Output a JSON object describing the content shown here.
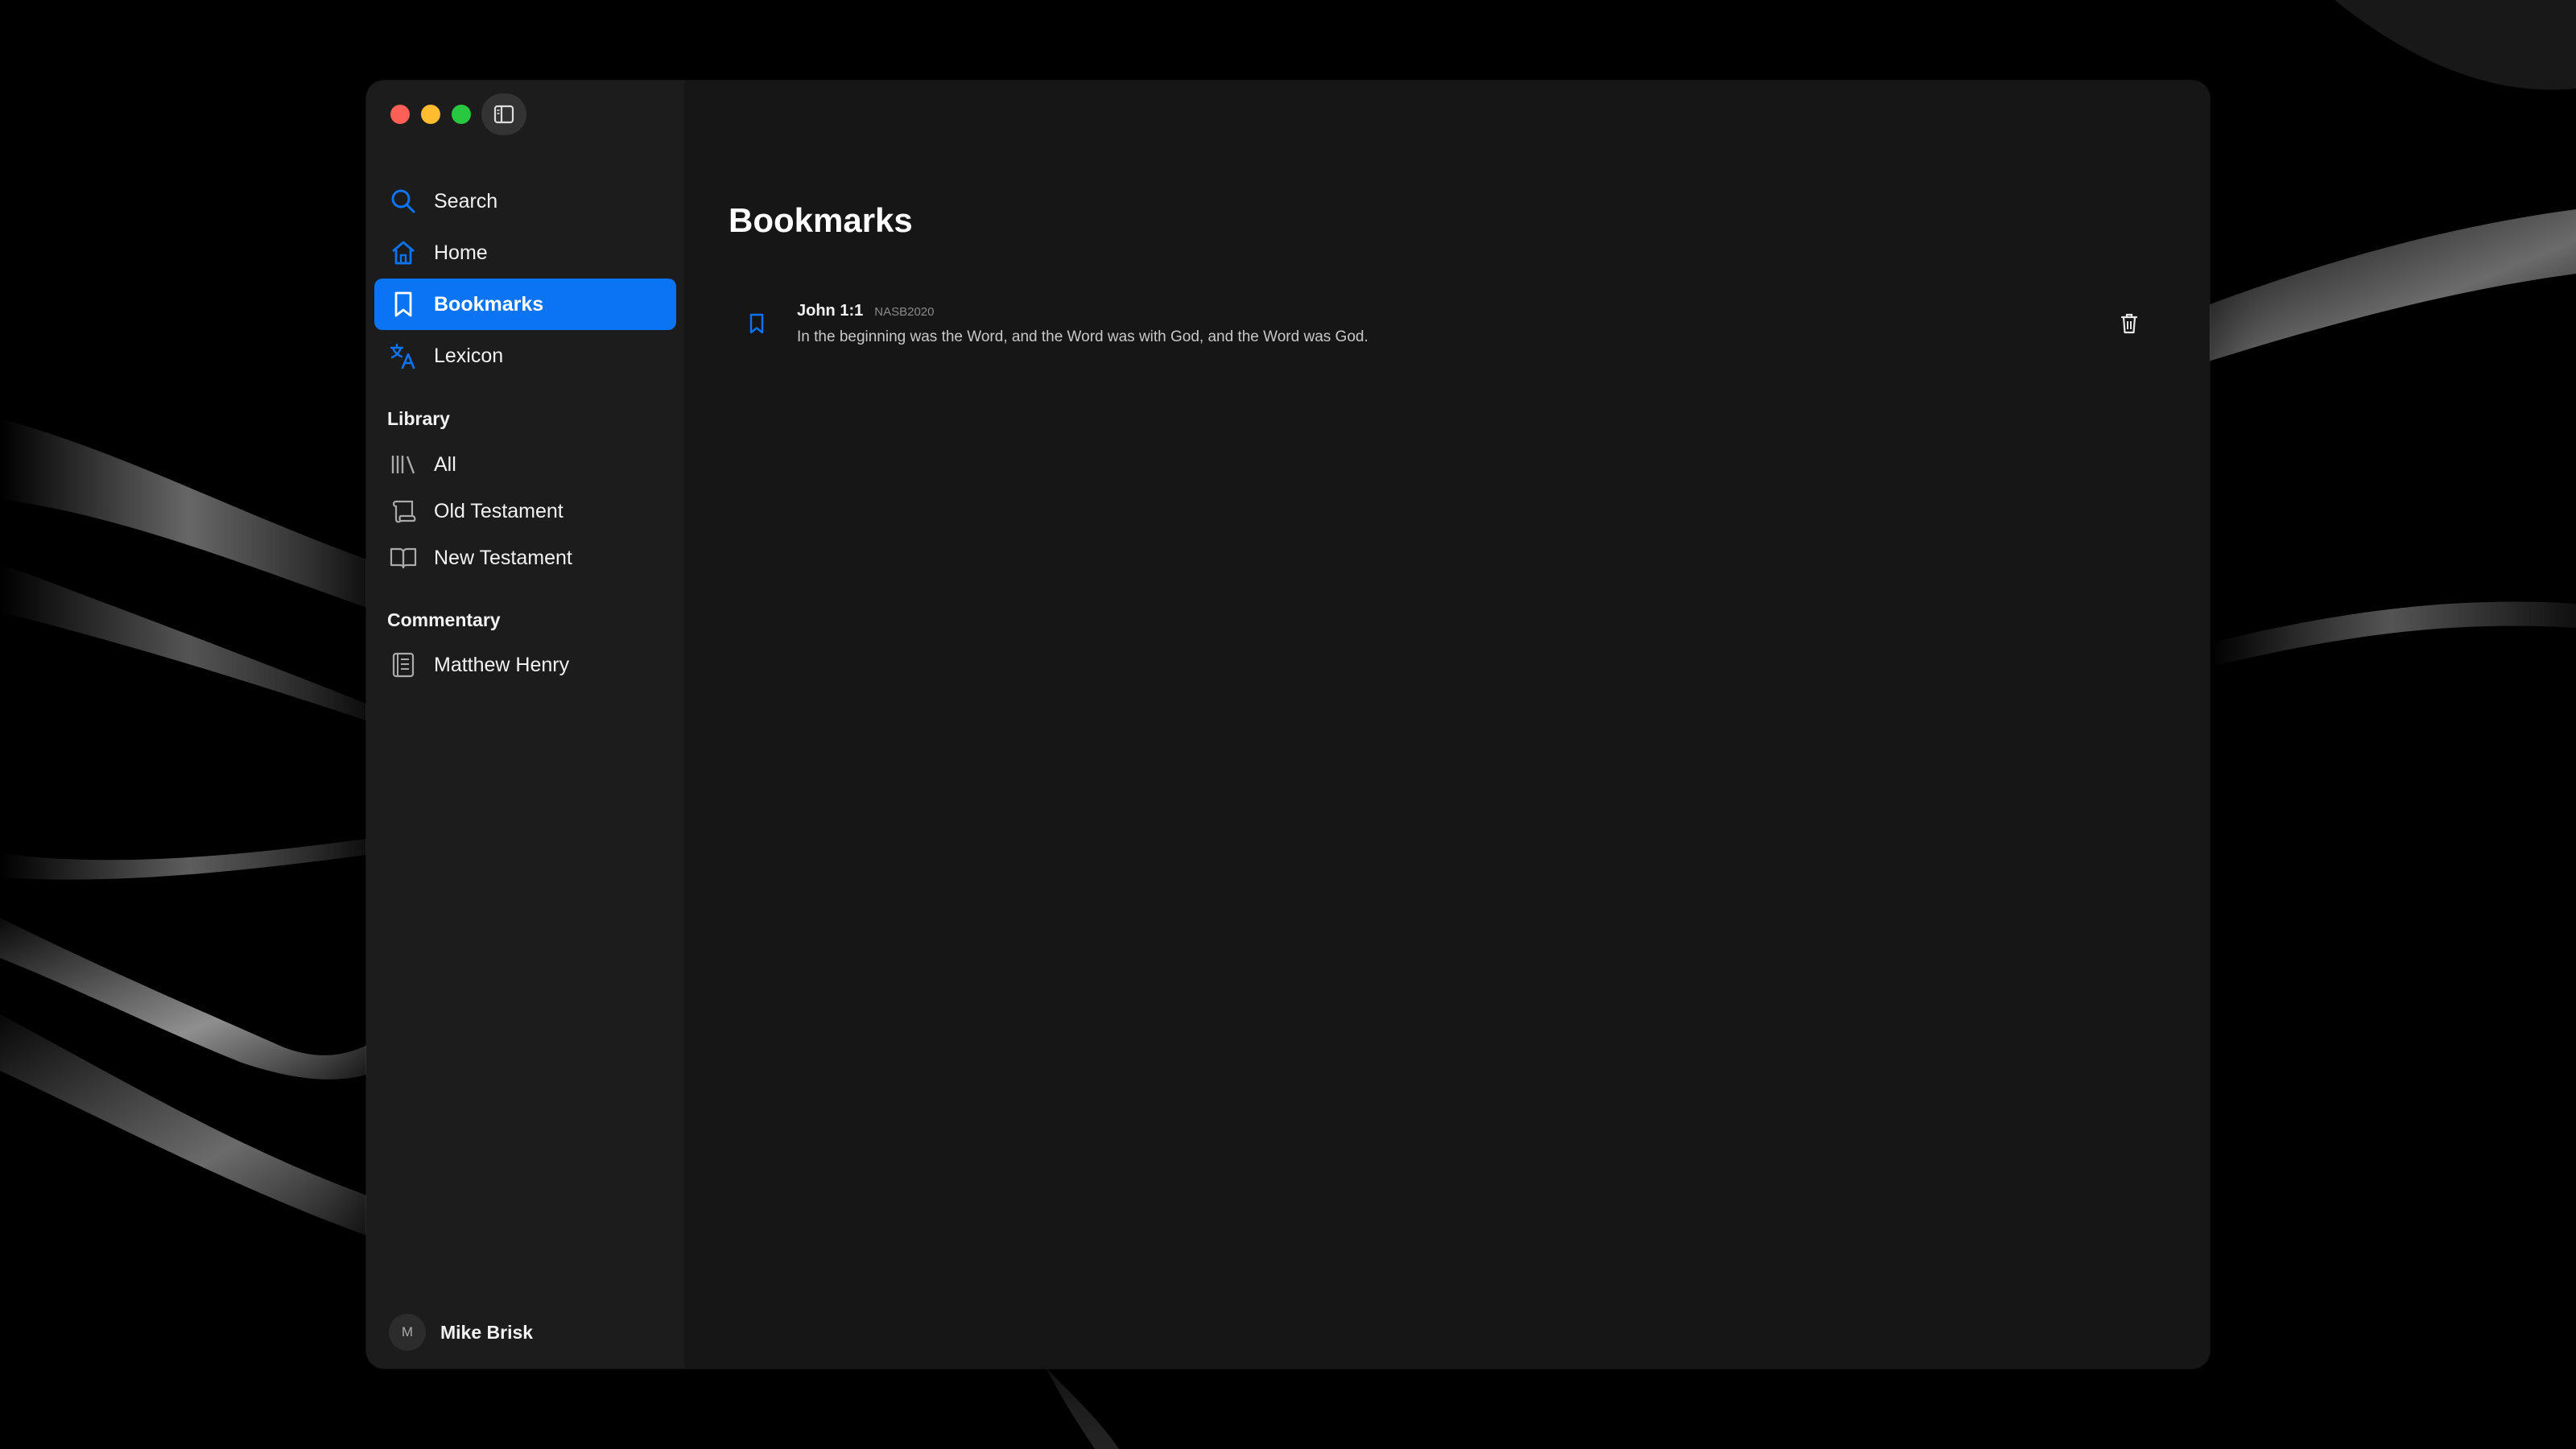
{
  "window": {
    "controls": [
      "close",
      "minimize",
      "zoom"
    ]
  },
  "sidebar": {
    "toggle_icon": "sidebar-icon",
    "nav": [
      {
        "label": "Search",
        "icon": "search-icon"
      },
      {
        "label": "Home",
        "icon": "home-icon"
      },
      {
        "label": "Bookmarks",
        "icon": "bookmark-icon",
        "active": true
      },
      {
        "label": "Lexicon",
        "icon": "translate-icon"
      }
    ],
    "library": {
      "title": "Library",
      "items": [
        {
          "label": "All",
          "icon": "books-icon"
        },
        {
          "label": "Old Testament",
          "icon": "scroll-icon"
        },
        {
          "label": "New Testament",
          "icon": "open-book-icon"
        }
      ]
    },
    "commentary": {
      "title": "Commentary",
      "items": [
        {
          "label": "Matthew Henry",
          "icon": "list-book-icon"
        }
      ]
    },
    "user": {
      "initial": "M",
      "name": "Mike Brisk"
    }
  },
  "main": {
    "title": "Bookmarks",
    "bookmarks": [
      {
        "reference": "John 1:1",
        "version": "NASB2020",
        "text": "In the beginning was the Word, and the Word was with God, and the Word was God."
      }
    ]
  },
  "colors": {
    "accent": "#0a74f5",
    "sidebar_bg": "#1c1c1c",
    "main_bg": "#161616"
  }
}
